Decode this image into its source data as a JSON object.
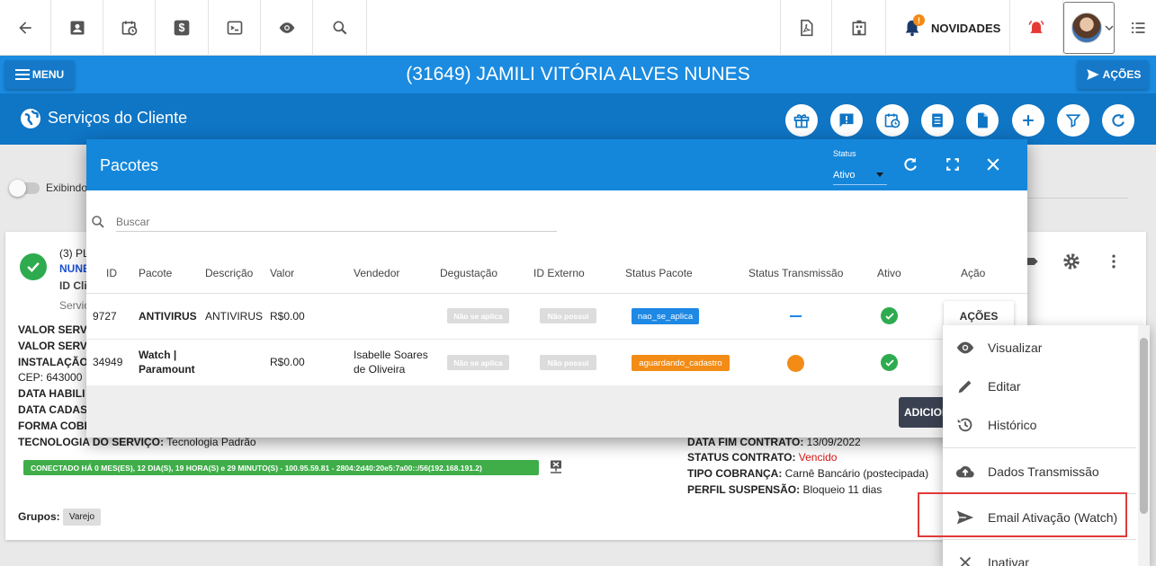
{
  "toolbar": {
    "novidades_label": "NOVIDADES",
    "novidades_badge": "!"
  },
  "header": {
    "menu_label": "MENU",
    "client_title": "(31649) JAMILI VITÓRIA ALVES NUNES",
    "acoes_label": "AÇÕES"
  },
  "section": {
    "title": "Serviços do Cliente"
  },
  "background": {
    "toggle_label": "Exibindo",
    "card_line1": "(3) PL",
    "card_line2": "NUNE",
    "card_line3": "ID Cli",
    "card_line4": "Servic",
    "valor_servico_1": "VALOR SERVI",
    "valor_servico_2": "VALOR SERVI",
    "instalacao": "INSTALAÇÃO",
    "cep": "CEP: 643000",
    "data_habilitacao": "DATA HABILI",
    "data_cadastro": "DATA CADAST",
    "forma_cobranca": "FORMA COBR",
    "tecnologia_label": "TECNOLOGIA DO SERVIÇO:",
    "tecnologia_value": "Tecnologia Padrão",
    "connection_text": "CONECTADO HÁ 0 MES(ES), 12 DIA(S), 19 HORA(S) e 29 MINUTO(S) - 100.95.59.81 - 2804:2d40:20e5:7a00::/56(192.168.191.2)",
    "grupos_label": "Grupos:",
    "grupo_value": "Varejo",
    "data_fim_label": "DATA FIM CONTRATO:",
    "data_fim_value": "13/09/2022",
    "status_contrato_label": "STATUS CONTRATO:",
    "status_contrato_value": "Vencido",
    "tipo_cobranca_label": "TIPO COBRANÇA:",
    "tipo_cobranca_value": "Carnê Bancário (postecipada)",
    "perfil_label": "PERFIL SUSPENSÃO:",
    "perfil_value": "Bloqueio 11 dias"
  },
  "modal": {
    "title": "Pacotes",
    "status_label": "Status",
    "status_value": "Ativo",
    "search_placeholder": "Buscar",
    "columns": [
      "ID",
      "Pacote",
      "Descrição",
      "Valor",
      "Vendedor",
      "Degustação",
      "ID Externo",
      "Status Pacote",
      "Status Transmissão",
      "Ativo",
      "Ação"
    ],
    "rows": [
      {
        "id": "9727",
        "pacote": "ANTIVIRUS",
        "descricao": "ANTIVIRUS",
        "valor": "R$0.00",
        "vendedor": "",
        "degustacao": "Não se aplica",
        "id_externo": "Não possui",
        "status_pacote": "nao_se_aplica",
        "status_pacote_color": "#1e88e5",
        "status_transmissao": "dash",
        "acao": "AÇÕES"
      },
      {
        "id": "34949",
        "pacote_line1": "Watch |",
        "pacote_line2": "Paramount",
        "descricao": "",
        "valor": "R$0.00",
        "vendedor_line1": "Isabelle Soares",
        "vendedor_line2": "de Oliveira",
        "degustacao": "Não se aplica",
        "id_externo": "Não possui",
        "status_pacote": "aguardando_cadastro",
        "status_pacote_color": "#f28c16",
        "status_transmissao": "orange-dot"
      }
    ],
    "add_button": "ADICIONAR"
  },
  "dropdown": {
    "items": [
      {
        "label": "Visualizar",
        "icon": "eye-icon"
      },
      {
        "label": "Editar",
        "icon": "pencil-icon"
      },
      {
        "label": "Histórico",
        "icon": "history-icon"
      },
      {
        "label": "Dados Transmissão",
        "icon": "cloud-upload-icon"
      },
      {
        "label": "Email Ativação (Watch)",
        "icon": "send-icon"
      },
      {
        "label": "Inativar",
        "icon": "close-icon"
      }
    ]
  },
  "colors": {
    "primary_blue": "#1a8be0",
    "section_blue": "#0f75c5",
    "success_green": "#2eab4f",
    "warning_orange": "#f28c16",
    "alert_red": "#e03a3a"
  }
}
